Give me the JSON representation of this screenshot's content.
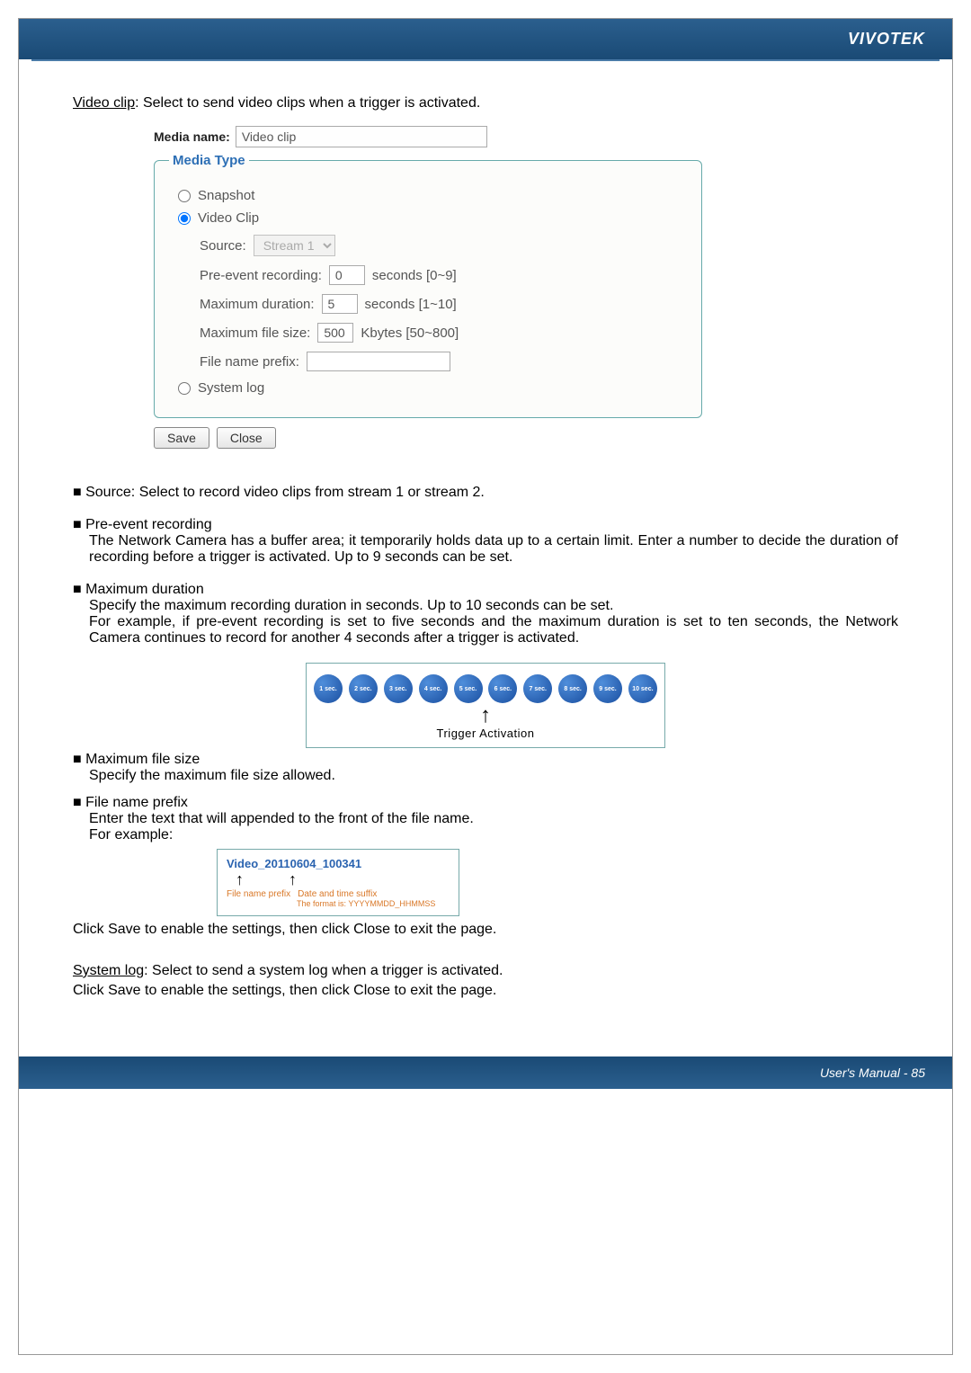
{
  "header": {
    "brand": "VIVOTEK"
  },
  "lead": {
    "underline": "Video clip",
    "rest": ": Select to send video clips when a trigger is activated."
  },
  "form": {
    "media_name_label": "Media name:",
    "media_name_value": "Video clip",
    "legend": "Media Type",
    "radio_snapshot": "Snapshot",
    "radio_videoclip": "Video Clip",
    "source_label": "Source:",
    "source_value": "Stream 1",
    "pre_label": "Pre-event recording:",
    "pre_value": "0",
    "pre_hint": "seconds [0~9]",
    "dur_label": "Maximum duration:",
    "dur_value": "5",
    "dur_hint": "seconds [1~10]",
    "size_label": "Maximum file size:",
    "size_value": "500",
    "size_hint": "Kbytes [50~800]",
    "prefix_label": "File name prefix:",
    "prefix_value": "",
    "radio_systemlog": "System log",
    "save_btn": "Save",
    "close_btn": "Close"
  },
  "bullets": {
    "b1": "Source: Select to record video clips from stream 1 or stream 2.",
    "b2t": "Pre-event recording",
    "b2d": "The Network Camera has a buffer area; it temporarily holds data up to a certain limit. Enter a number to decide the duration of recording before a trigger is activated. Up to 9 seconds can be set.",
    "b3t": "Maximum duration",
    "b3d1": "Specify the maximum recording duration in seconds. Up to 10 seconds can be set.",
    "b3d2": "For example, if pre-event recording is set to five seconds and the maximum duration is set to ten seconds, the Network Camera continues to record for another 4 seconds after a trigger is activated.",
    "b4t": "Maximum file size",
    "b4d": "Specify the maximum file size allowed.",
    "b5t": "File name prefix",
    "b5d1": "Enter the text that will appended to the front of the file name.",
    "b5d2": " For example:"
  },
  "chart_data": {
    "type": "bar",
    "categories": [
      "1 sec.",
      "2 sec.",
      "3 sec.",
      "4 sec.",
      "5 sec.",
      "6 sec.",
      "7 sec.",
      "8 sec.",
      "9 sec.",
      "10 sec."
    ],
    "values": [
      1,
      1,
      1,
      1,
      1,
      1,
      1,
      1,
      1,
      1
    ],
    "highlight_index": 5,
    "title": "Trigger Activation"
  },
  "timeline": {
    "dots": [
      "1 sec.",
      "2 sec.",
      "3 sec.",
      "4 sec.",
      "5 sec.",
      "6 sec.",
      "7 sec.",
      "8 sec.",
      "9 sec.",
      "10 sec."
    ],
    "label": "Trigger Activation"
  },
  "example": {
    "filename": "Video_20110604_100341",
    "p1": "File name prefix",
    "p2": "Date and time suffix",
    "fmt": "The format is: YYYYMMDD_HHMMSS"
  },
  "after_example": "Click Save to enable the settings, then click Close to exit the page.",
  "syslog": {
    "underline": "System log",
    "rest": ": Select to send a system log when a trigger is activated.",
    "line2": "Click Save to enable the settings, then click Close to exit the page."
  },
  "footer": {
    "text": "User's Manual - 85"
  }
}
